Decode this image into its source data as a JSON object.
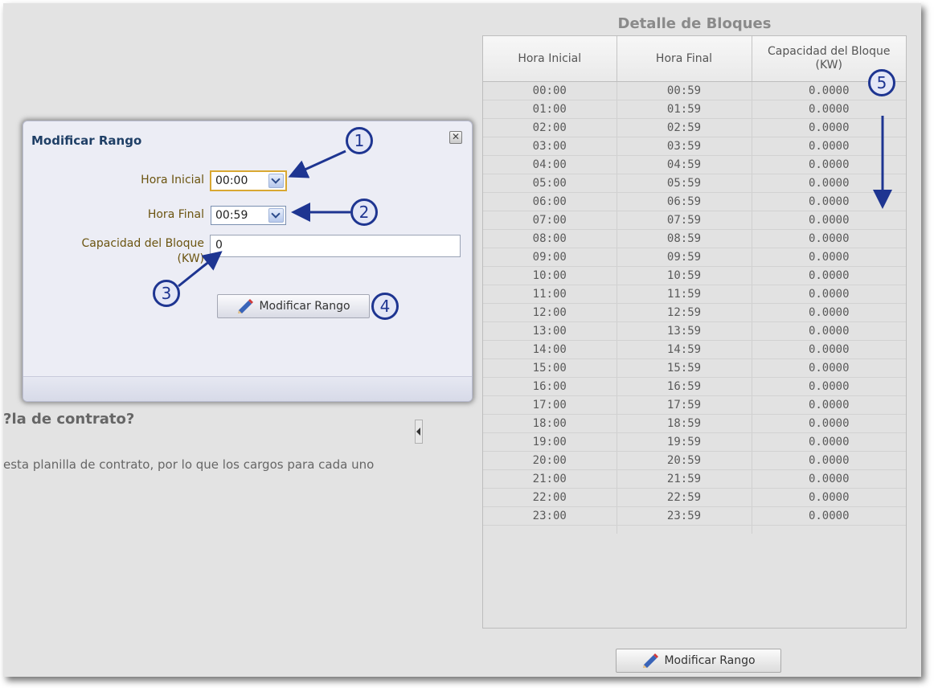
{
  "background": {
    "heading": "?la de contrato?",
    "text": "esta planilla de contrato, por lo que los cargos para cada uno"
  },
  "detail": {
    "title": "Detalle de Bloques",
    "headers": [
      "Hora Inicial",
      "Hora Final",
      "Capacidad del Bloque (KW)"
    ],
    "rows": [
      [
        "00:00",
        "00:59",
        "0.0000"
      ],
      [
        "01:00",
        "01:59",
        "0.0000"
      ],
      [
        "02:00",
        "02:59",
        "0.0000"
      ],
      [
        "03:00",
        "03:59",
        "0.0000"
      ],
      [
        "04:00",
        "04:59",
        "0.0000"
      ],
      [
        "05:00",
        "05:59",
        "0.0000"
      ],
      [
        "06:00",
        "06:59",
        "0.0000"
      ],
      [
        "07:00",
        "07:59",
        "0.0000"
      ],
      [
        "08:00",
        "08:59",
        "0.0000"
      ],
      [
        "09:00",
        "09:59",
        "0.0000"
      ],
      [
        "10:00",
        "10:59",
        "0.0000"
      ],
      [
        "11:00",
        "11:59",
        "0.0000"
      ],
      [
        "12:00",
        "12:59",
        "0.0000"
      ],
      [
        "13:00",
        "13:59",
        "0.0000"
      ],
      [
        "14:00",
        "14:59",
        "0.0000"
      ],
      [
        "15:00",
        "15:59",
        "0.0000"
      ],
      [
        "16:00",
        "16:59",
        "0.0000"
      ],
      [
        "17:00",
        "17:59",
        "0.0000"
      ],
      [
        "18:00",
        "18:59",
        "0.0000"
      ],
      [
        "19:00",
        "19:59",
        "0.0000"
      ],
      [
        "20:00",
        "20:59",
        "0.0000"
      ],
      [
        "21:00",
        "21:59",
        "0.0000"
      ],
      [
        "22:00",
        "22:59",
        "0.0000"
      ],
      [
        "23:00",
        "23:59",
        "0.0000"
      ]
    ],
    "button_label": "Modificar Rango"
  },
  "dialog": {
    "title": "Modificar Rango",
    "close_icon": "close-icon",
    "hora_inicial_label": "Hora Inicial",
    "hora_inicial_value": "00:00",
    "hora_final_label": "Hora Final",
    "hora_final_value": "00:59",
    "capacidad_label_line1": "Capacidad del Bloque",
    "capacidad_label_line2": "(KW)",
    "capacidad_value": "0",
    "button_label": "Modificar Rango",
    "button_icon": "pencil-icon"
  },
  "annotations": {
    "callouts": [
      "1",
      "2",
      "3",
      "4",
      "5"
    ],
    "color": "#1e3591"
  }
}
